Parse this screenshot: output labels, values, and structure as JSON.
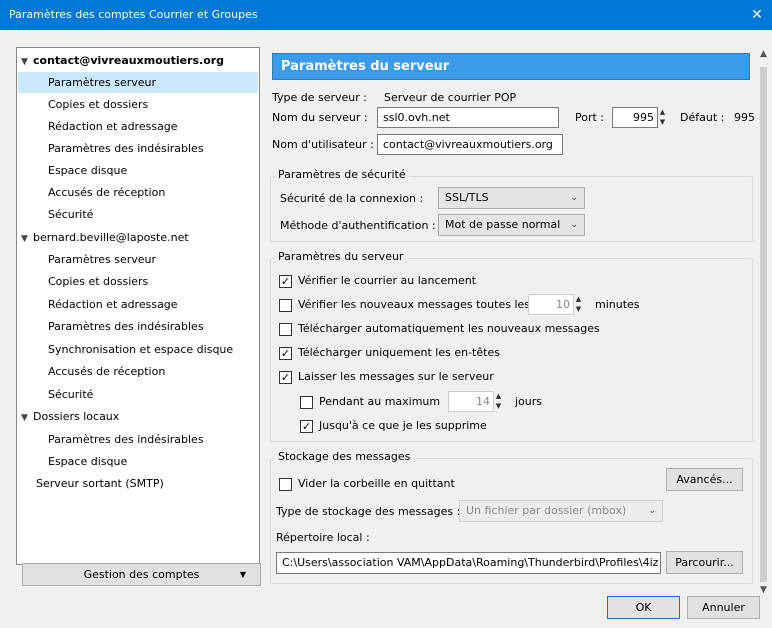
{
  "window": {
    "title": "Paramètres des comptes Courrier et Groupes",
    "close_glyph": "✕"
  },
  "tree": {
    "accounts": [
      {
        "name": "contact@vivreauxmoutiers.org",
        "items": [
          "Paramètres serveur",
          "Copies et dossiers",
          "Rédaction et adressage",
          "Paramètres des indésirables",
          "Espace disque",
          "Accusés de réception",
          "Sécurité"
        ]
      },
      {
        "name": "bernard.beville@laposte.net",
        "items": [
          "Paramètres serveur",
          "Copies et dossiers",
          "Rédaction et adressage",
          "Paramètres des indésirables",
          "Synchronisation et espace disque",
          "Accusés de réception",
          "Sécurité"
        ]
      },
      {
        "name": "Dossiers locaux",
        "items": [
          "Paramètres des indésirables",
          "Espace disque"
        ]
      }
    ],
    "smtp": "Serveur sortant (SMTP)",
    "selected": "contact@vivreauxmoutiers.org / Paramètres serveur"
  },
  "manage_button": "Gestion des comptes",
  "server": {
    "header": "Paramètres du serveur",
    "type_label": "Type de serveur :",
    "type_value": "Serveur de courrier POP",
    "name_label": "Nom du serveur :",
    "name_value": "ssl0.ovh.net",
    "port_label": "Port :",
    "port_value": "995",
    "default_label": "Défaut :",
    "default_value": "995",
    "user_label": "Nom d'utilisateur :",
    "user_value": "contact@vivreauxmoutiers.org"
  },
  "security": {
    "title": "Paramètres de sécurité",
    "conn_label": "Sécurité de la connexion :",
    "conn_value": "SSL/TLS",
    "auth_label": "Méthode d'authentification :",
    "auth_value": "Mot de passe normal"
  },
  "server_settings": {
    "title": "Paramètres du serveur",
    "check_startup": {
      "label": "Vérifier le courrier au lancement",
      "checked": true
    },
    "check_every": {
      "label": "Vérifier les nouveaux messages toutes les",
      "checked": false,
      "value": "10",
      "unit": "minutes"
    },
    "auto_download": {
      "label": "Télécharger automatiquement les nouveaux messages",
      "checked": false
    },
    "headers_only": {
      "label": "Télécharger uniquement les en-têtes",
      "checked": true
    },
    "leave_on_server": {
      "label": "Laisser les messages sur le serveur",
      "checked": true
    },
    "max_days": {
      "label": "Pendant au maximum",
      "checked": false,
      "value": "14",
      "unit": "jours"
    },
    "until_delete": {
      "label": "Jusqu'à ce que je les supprime",
      "checked": true
    }
  },
  "storage": {
    "title": "Stockage des messages",
    "empty_trash": {
      "label": "Vider la corbeille en quittant",
      "checked": false
    },
    "advanced_button": "Avancés...",
    "type_label": "Type de stockage des messages :",
    "type_value": "Un fichier par dossier (mbox)",
    "dir_label": "Répertoire local :",
    "dir_value": "C:\\Users\\association VAM\\AppData\\Roaming\\Thunderbird\\Profiles\\4iz",
    "browse_button": "Parcourir..."
  },
  "footer": {
    "ok": "OK",
    "cancel": "Annuler"
  },
  "icons": {
    "check": "✓",
    "chevron_down": "⌄",
    "spin_up": "▲",
    "spin_down": "▼",
    "scroll_up": "▲",
    "scroll_down": "▼"
  },
  "colors": {
    "titlebar": "#0078d7",
    "header": "#3d9ae8",
    "selection": "#cce8ff"
  }
}
